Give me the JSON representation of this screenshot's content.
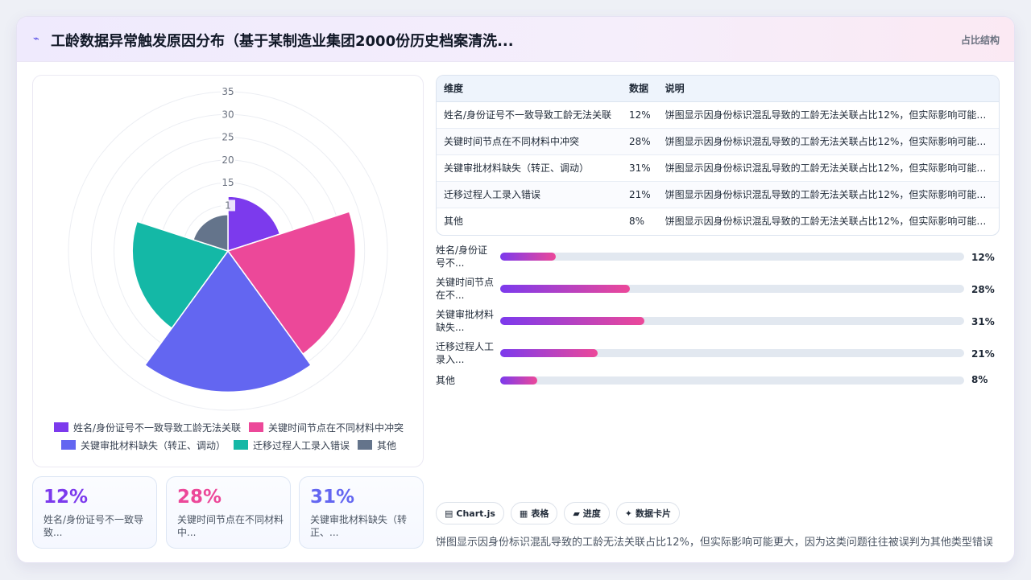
{
  "header": {
    "icon": "pulse-icon",
    "title": "工龄数据异常触发原因分布（基于某制造业集团2000份历史档案清洗...",
    "tag": "占比结构"
  },
  "chart_data": {
    "type": "polarArea",
    "categories": [
      "姓名/身份证号不一致导致工龄无法关联",
      "关键时间节点在不同材料中冲突",
      "关键审批材料缺失（转正、调动）",
      "迁移过程人工录入错误",
      "其他"
    ],
    "values": [
      12,
      28,
      31,
      21,
      8
    ],
    "colors": [
      "#7c3aed",
      "#ec4899",
      "#6366f1",
      "#14b8a6",
      "#64748b"
    ],
    "rlim": [
      0,
      35
    ],
    "ticks": [
      "35",
      "30",
      "25",
      "20",
      "15",
      "1"
    ],
    "grid": true,
    "legend": "bottom"
  },
  "table": {
    "headers": [
      "维度",
      "数据",
      "说明"
    ],
    "rows": [
      {
        "dim": "姓名/身份证号不一致导致工龄无法关联",
        "val": "12%",
        "desc": "饼图显示因身份标识混乱导致的工龄无法关联占比12%，但实际影响可能更..."
      },
      {
        "dim": "关键时间节点在不同材料中冲突",
        "val": "28%",
        "desc": "饼图显示因身份标识混乱导致的工龄无法关联占比12%，但实际影响可能更..."
      },
      {
        "dim": "关键审批材料缺失（转正、调动）",
        "val": "31%",
        "desc": "饼图显示因身份标识混乱导致的工龄无法关联占比12%，但实际影响可能更..."
      },
      {
        "dim": "迁移过程人工录入错误",
        "val": "21%",
        "desc": "饼图显示因身份标识混乱导致的工龄无法关联占比12%，但实际影响可能更..."
      },
      {
        "dim": "其他",
        "val": "8%",
        "desc": "饼图显示因身份标识混乱导致的工龄无法关联占比12%，但实际影响可能更..."
      }
    ]
  },
  "progress": [
    {
      "label": "姓名/身份证号不...",
      "pct": "12%",
      "value": 12
    },
    {
      "label": "关键时间节点在不...",
      "pct": "28%",
      "value": 28
    },
    {
      "label": "关键审批材料缺失...",
      "pct": "31%",
      "value": 31
    },
    {
      "label": "迁移过程人工录入...",
      "pct": "21%",
      "value": 21
    },
    {
      "label": "其他",
      "pct": "8%",
      "value": 8
    }
  ],
  "kpis": [
    {
      "value": "12%",
      "label": "姓名/身份证号不一致导致...",
      "color": "#7c3aed"
    },
    {
      "value": "28%",
      "label": "关键时间节点在不同材料中...",
      "color": "#ec4899"
    },
    {
      "value": "31%",
      "label": "关键审批材料缺失（转正、...",
      "color": "#6366f1"
    }
  ],
  "buttons": [
    {
      "icon": "chart-icon",
      "glyph": "▤",
      "label": "Chart.js"
    },
    {
      "icon": "table-icon",
      "glyph": "▦",
      "label": "表格"
    },
    {
      "icon": "progress-icon",
      "glyph": "▰",
      "label": "进度"
    },
    {
      "icon": "sparkle-icon",
      "glyph": "✦",
      "label": "数据卡片"
    }
  ],
  "note": "饼图显示因身份标识混乱导致的工龄无法关联占比12%，但实际影响可能更大，因为这类问题往往被误判为其他类型错误"
}
